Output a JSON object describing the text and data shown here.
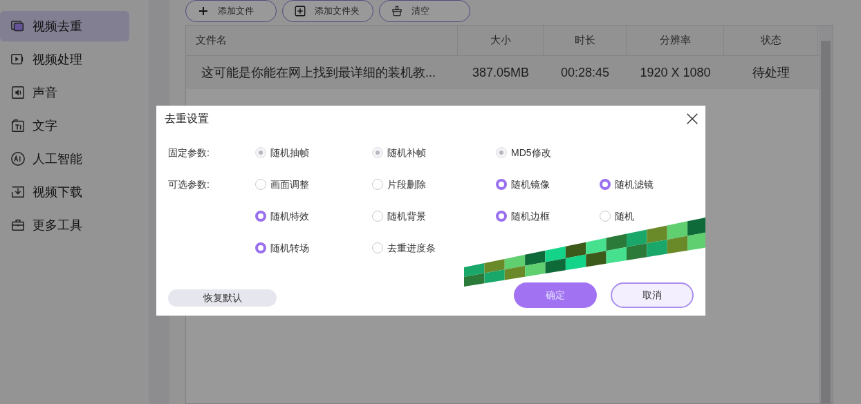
{
  "sidebar": {
    "items": [
      {
        "label": "视频去重",
        "selected": true
      },
      {
        "label": "视频处理",
        "selected": false
      },
      {
        "label": "声音",
        "selected": false
      },
      {
        "label": "文字",
        "selected": false
      },
      {
        "label": "人工智能",
        "selected": false
      },
      {
        "label": "视频下载",
        "selected": false
      },
      {
        "label": "更多工具",
        "selected": false
      }
    ]
  },
  "toolbar": [
    {
      "label": "添加文件"
    },
    {
      "label": "添加文件夹"
    },
    {
      "label": "清空"
    }
  ],
  "table": {
    "columns": [
      "文件名",
      "大小",
      "时长",
      "分辨率",
      "状态"
    ],
    "rows": [
      [
        "这可能是你能在网上找到最详细的装机教...",
        "387.05MB",
        "00:28:45",
        "1920 X 1080",
        "待处理"
      ]
    ]
  },
  "dialog": {
    "title": "去重设置",
    "groups": [
      {
        "label": "固定参数:",
        "options": [
          {
            "label": "随机抽帧",
            "checked": true,
            "disabled": true
          },
          {
            "label": "随机补帧",
            "checked": true,
            "disabled": true
          },
          {
            "label": "MD5修改",
            "checked": true,
            "disabled": true
          }
        ]
      },
      {
        "label": "可选参数:",
        "options": [
          {
            "label": "画面调整",
            "checked": false,
            "disabled": false
          },
          {
            "label": "片段删除",
            "checked": false,
            "disabled": false
          },
          {
            "label": "随机镜像",
            "checked": true,
            "disabled": false
          },
          {
            "label": "随机滤镜",
            "checked": true,
            "disabled": false
          },
          {
            "label": "随机特效",
            "checked": true,
            "disabled": false
          },
          {
            "label": "随机背景",
            "checked": false,
            "disabled": false
          },
          {
            "label": "随机边框",
            "checked": true,
            "disabled": false
          },
          {
            "label": "随机",
            "checked": false,
            "disabled": false
          },
          {
            "label": "随机转场",
            "checked": true,
            "disabled": false
          },
          {
            "label": "去重进度条",
            "checked": false,
            "disabled": false
          }
        ]
      }
    ],
    "reset_button": "恢复默认",
    "ok_button": "确定",
    "cancel_button": "取消"
  }
}
